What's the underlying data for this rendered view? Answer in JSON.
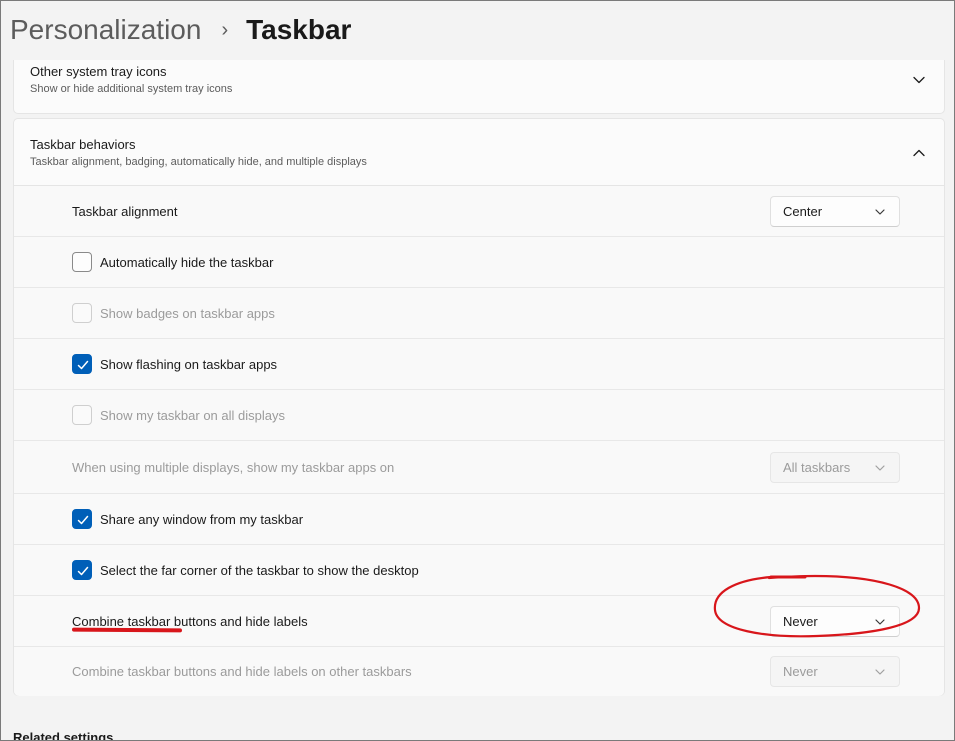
{
  "breadcrumb": {
    "parent": "Personalization",
    "separator": "›",
    "current": "Taskbar"
  },
  "tray_card": {
    "title": "Other system tray icons",
    "description": "Show or hide additional system tray icons",
    "expanded": false
  },
  "behaviors_card": {
    "title": "Taskbar behaviors",
    "description": "Taskbar alignment, badging, automatically hide, and multiple displays",
    "expanded": true
  },
  "settings": {
    "alignment": {
      "label": "Taskbar alignment",
      "value": "Center"
    },
    "auto_hide": {
      "label": "Automatically hide the taskbar",
      "checked": false,
      "enabled": true
    },
    "badges": {
      "label": "Show badges on taskbar apps",
      "checked": false,
      "enabled": false
    },
    "flashing": {
      "label": "Show flashing on taskbar apps",
      "checked": true,
      "enabled": true
    },
    "all_displays": {
      "label": "Show my taskbar on all displays",
      "checked": false,
      "enabled": false
    },
    "multi_display_apps": {
      "label": "When using multiple displays, show my taskbar apps on",
      "value": "All taskbars",
      "enabled": false
    },
    "share_window": {
      "label": "Share any window from my taskbar",
      "checked": true,
      "enabled": true
    },
    "far_corner": {
      "label": "Select the far corner of the taskbar to show the desktop",
      "checked": true,
      "enabled": true
    },
    "combine": {
      "label": "Combine taskbar buttons and hide labels",
      "value": "Never",
      "enabled": true
    },
    "combine_other": {
      "label": "Combine taskbar buttons and hide labels on other taskbars",
      "value": "Never",
      "enabled": false
    }
  },
  "related_settings": {
    "label": "Related settings"
  },
  "colors": {
    "accent": "#005fb8",
    "annotation_red": "#d8161b"
  }
}
